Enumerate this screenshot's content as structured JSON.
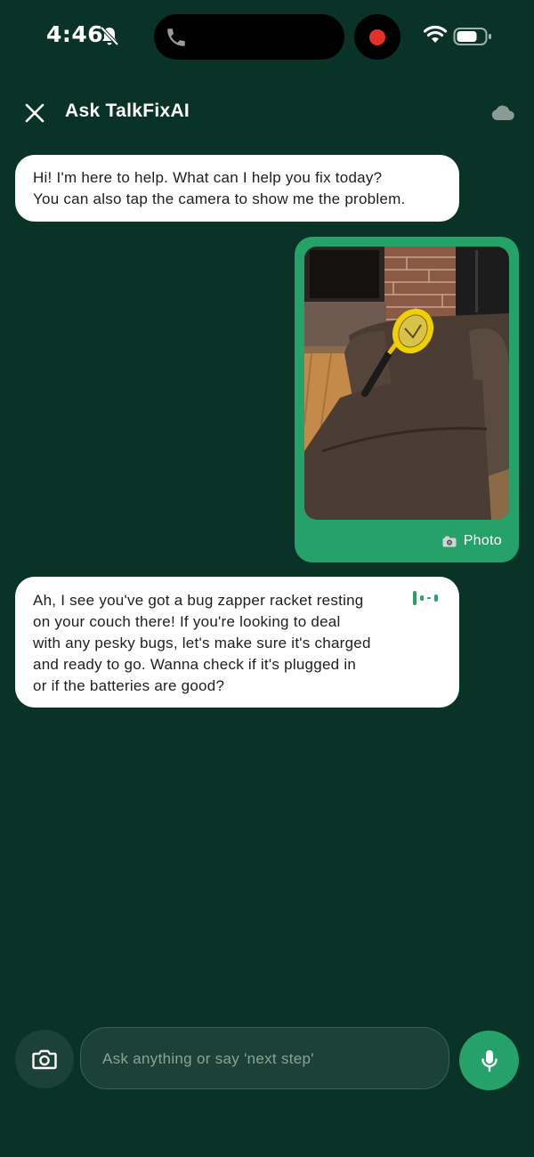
{
  "status_bar": {
    "time": "4:46"
  },
  "header": {
    "title": "Ask TalkFixAI"
  },
  "messages": [
    {
      "sender": "assistant",
      "text": "Hi! I'm here to help. What can I help you fix today?\nYou can also tap the camera to show me the problem."
    },
    {
      "sender": "user",
      "type": "photo",
      "caption": "Photo",
      "caption_icon": "camera-emoji-icon"
    },
    {
      "sender": "assistant",
      "text": "Ah, I see you've got a bug zapper racket resting\non your couch there! If you're looking to deal\nwith any pesky bugs, let's make sure it's charged\nand ready to go. Wanna check if it's plugged in\nor if the batteries are good?",
      "icon": "audio-wave-icon"
    }
  ],
  "input_bar": {
    "placeholder": "Ask anything or say 'next step'",
    "value": ""
  },
  "colors": {
    "background": "#0a3327",
    "accent": "#27a16a",
    "assistant_bubble": "#ffffff",
    "input_bg": "#1c4137"
  }
}
